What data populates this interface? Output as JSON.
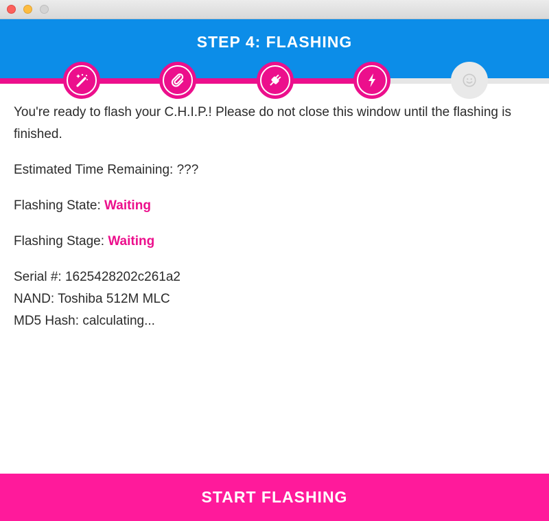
{
  "window": {
    "controls": [
      "close",
      "minimize",
      "maximize"
    ]
  },
  "header": {
    "title": "STEP 4: FLASHING",
    "background_color": "#0c8de8"
  },
  "steps": [
    {
      "icon": "magic-wand-icon",
      "state": "done"
    },
    {
      "icon": "paperclip-icon",
      "state": "done"
    },
    {
      "icon": "plug-icon",
      "state": "done"
    },
    {
      "icon": "lightning-bolt-icon",
      "state": "current"
    },
    {
      "icon": "smiley-face-icon",
      "state": "pending"
    }
  ],
  "progress": {
    "completed_steps": 4,
    "total_steps": 5,
    "accent_color": "#ec0f8c"
  },
  "content": {
    "intro": "You're ready to flash your C.H.I.P.! Please do not close this window until the flashing is finished.",
    "time_remaining_label": "Estimated Time Remaining: ",
    "time_remaining_value": "???",
    "state_label": "Flashing State: ",
    "state_value": "Waiting",
    "stage_label": "Flashing Stage: ",
    "stage_value": "Waiting",
    "serial_label": "Serial #: ",
    "serial_value": "1625428202c261a2",
    "nand_label": "NAND: ",
    "nand_value": "Toshiba 512M MLC",
    "md5_label": "MD5 Hash: ",
    "md5_value": "calculating..."
  },
  "footer": {
    "start_button_label": "START FLASHING",
    "button_color": "#ff1a9b"
  }
}
